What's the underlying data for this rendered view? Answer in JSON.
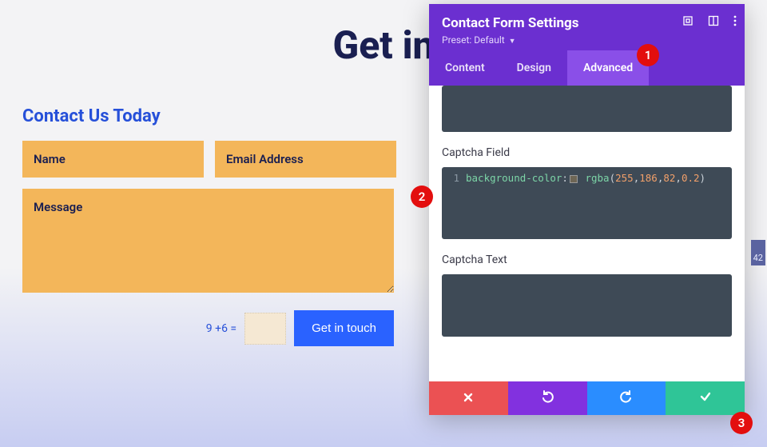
{
  "page": {
    "heading": "Get in",
    "contact_title": "Contact Us Today",
    "name_placeholder": "Name",
    "email_placeholder": "Email Address",
    "message_placeholder": "Message",
    "captcha_label": "9 +6 =",
    "submit_label": "Get in touch"
  },
  "panel": {
    "title": "Contact Form Settings",
    "preset_label": "Preset:",
    "preset_value": "Default",
    "tabs": {
      "content": "Content",
      "design": "Design",
      "advanced": "Advanced"
    },
    "section_captcha_field": "Captcha Field",
    "section_captcha_text": "Captcha Text",
    "code": {
      "line_num": "1",
      "prop": "background-color",
      "func": "rgba",
      "v1": "255",
      "v2": "186",
      "v3": "82",
      "v4": "0.2"
    }
  },
  "badges": {
    "b1": "1",
    "b2": "2",
    "b3": "3"
  },
  "edge": {
    "num": "42"
  }
}
